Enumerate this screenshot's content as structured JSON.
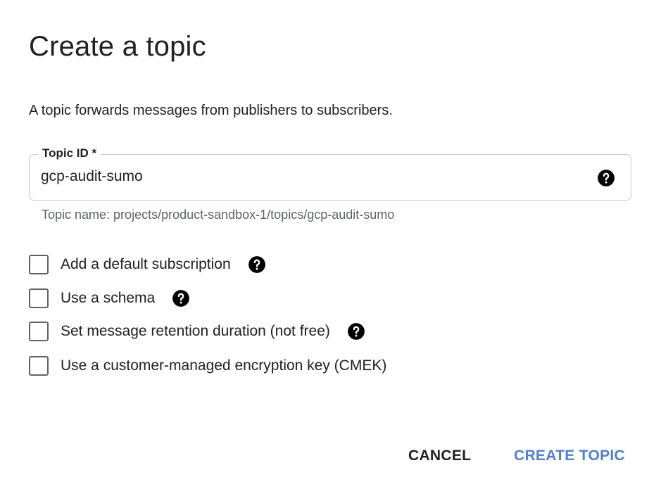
{
  "dialog": {
    "title": "Create a topic",
    "description": "A topic forwards messages from publishers to subscribers."
  },
  "topic_field": {
    "label": "Topic ID *",
    "value": "gcp-audit-sumo",
    "help_icon": "help-circle-icon",
    "helper_text": "Topic name: projects/product-sandbox-1/topics/gcp-audit-sumo"
  },
  "options": [
    {
      "label": "Add a default subscription",
      "checked": false,
      "has_help": true
    },
    {
      "label": "Use a schema",
      "checked": false,
      "has_help": true
    },
    {
      "label": "Set message retention duration (not free)",
      "checked": false,
      "has_help": true
    },
    {
      "label": "Use a customer-managed encryption key (CMEK)",
      "checked": false,
      "has_help": false
    }
  ],
  "actions": {
    "cancel_label": "CANCEL",
    "create_label": "CREATE TOPIC"
  },
  "colors": {
    "primary": "#4d7fd6",
    "text": "#202124",
    "secondary_text": "#5f6368",
    "border": "#c7c9cc"
  }
}
